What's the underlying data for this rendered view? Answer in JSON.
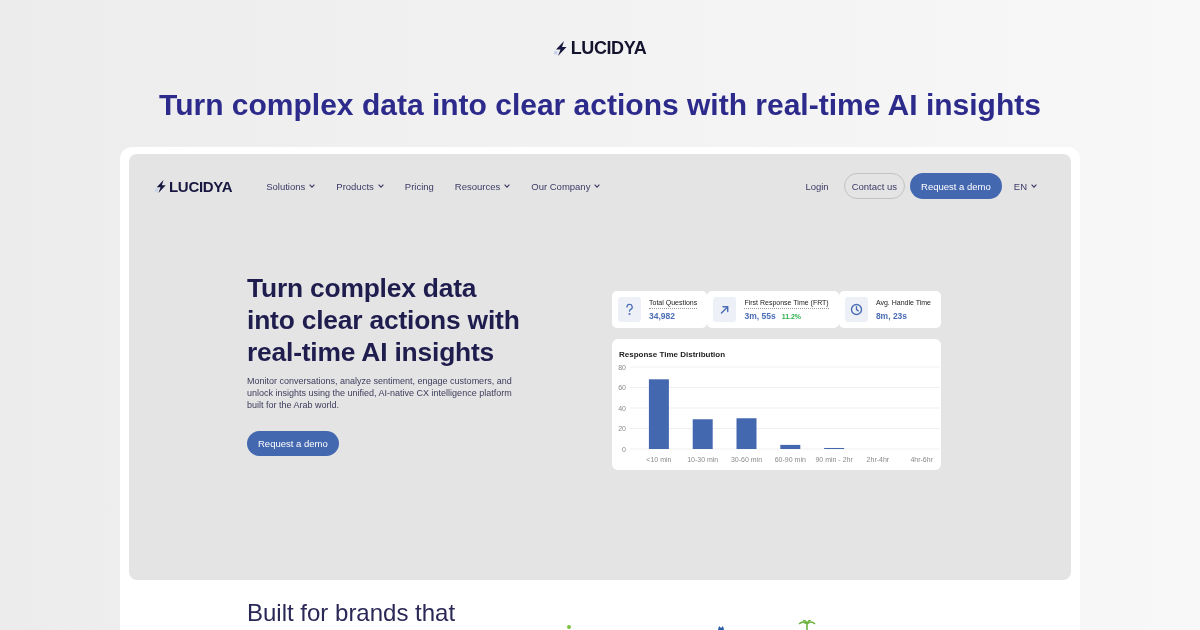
{
  "brand": {
    "logo": "LUCIDYA"
  },
  "headline": "Turn complex data into clear actions with real-time AI insights",
  "screenshot": {
    "nav": {
      "logo": "LUCIDYA",
      "items": [
        {
          "label": "Solutions",
          "dropdown": true
        },
        {
          "label": "Products",
          "dropdown": true
        },
        {
          "label": "Pricing",
          "dropdown": false
        },
        {
          "label": "Resources",
          "dropdown": true
        },
        {
          "label": "Our Company",
          "dropdown": true
        }
      ],
      "login": "Login",
      "contact_button": "Contact us",
      "demo_button": "Request a demo",
      "language": {
        "label": "EN",
        "dropdown": true
      }
    },
    "hero": {
      "title": "Turn complex data into clear actions with real-time AI insights",
      "description": "Monitor conversations, analyze sentiment, engage customers, and unlock insights using the unified, AI-native CX intelligence platform built for the Arab world.",
      "button": "Request a demo"
    },
    "stats": [
      {
        "label": "Total Questions",
        "value": "34,982",
        "dotted_underline": true
      },
      {
        "label": "First Response Time (FRT)",
        "value": "3m, 55s",
        "change": "11.2%",
        "dotted_underline": true
      },
      {
        "label": "Avg. Handle Time",
        "value": "8m, 23s",
        "dotted_underline": false
      }
    ],
    "response_chart": {
      "chart_data": {
        "type": "bar",
        "title": "Response Time Distribution",
        "categories": [
          "<10 min",
          "10-30 min",
          "30-60 min",
          "60-90 min",
          "90 min - 2hr",
          "2hr-4hr",
          "4hr-6hr"
        ],
        "values": [
          68,
          29,
          30,
          4,
          1,
          0,
          0
        ],
        "ylim": [
          0,
          80
        ],
        "yticks": [
          0,
          20,
          40,
          60,
          80
        ],
        "grid": true
      }
    }
  },
  "next_section": {
    "heading": "Built for brands that"
  }
}
